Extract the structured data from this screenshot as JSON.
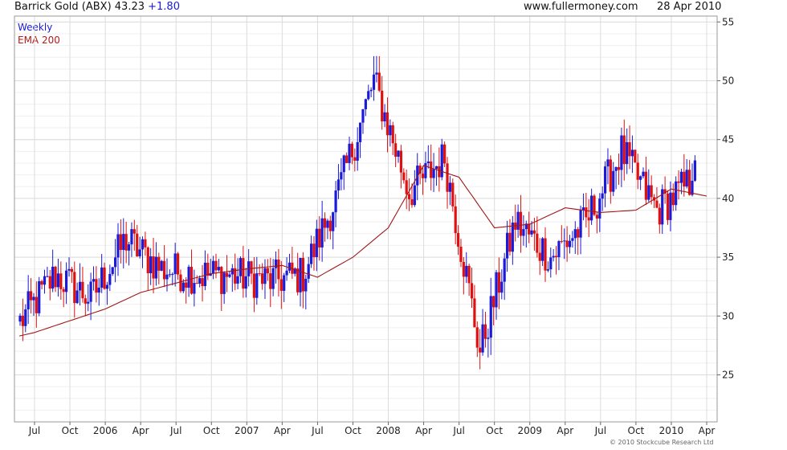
{
  "header": {
    "title": "Barrick Gold (ABX) 43.23",
    "change": "+1.80",
    "site": "www.fullermoney.com",
    "date": "28 Apr 2010"
  },
  "legend": {
    "weekly": "Weekly",
    "ema": "EMA 200"
  },
  "copyright": "© 2010 Stockcube Research Ltd",
  "chart_data": {
    "type": "candlestick",
    "title": "Barrick Gold (ABX) 43.23 +1.80",
    "frequency": "Weekly",
    "xlabel": "",
    "ylabel": "",
    "ylim": [
      21,
      55.5
    ],
    "y_ticks": [
      25,
      30,
      35,
      40,
      45,
      50,
      55
    ],
    "x_ticks": [
      "Jul",
      "Oct",
      "2006",
      "Apr",
      "Jul",
      "Oct",
      "2007",
      "Apr",
      "Jul",
      "Oct",
      "2008",
      "Apr",
      "Jul",
      "Oct",
      "2009",
      "Apr",
      "Jul",
      "Oct",
      "2010",
      "Apr"
    ],
    "grid": true,
    "legend_position": "top-left",
    "colors": {
      "up": "#1a1ad8",
      "down": "#e01010",
      "ema": "#a01818",
      "grid": "#dcdcdc"
    },
    "series": [
      {
        "name": "Weekly",
        "kind": "price-close",
        "points": [
          [
            "Jul",
            29.5
          ],
          [
            "Oct",
            33.5
          ],
          [
            "2006",
            31.5
          ],
          [
            "Apr",
            36.5
          ],
          [
            "Jul",
            34.0
          ],
          [
            "Oct",
            33.5
          ],
          [
            "2007",
            33.5
          ],
          [
            "Apr",
            33.0
          ],
          [
            "Jul",
            33.5
          ],
          [
            "Oct",
            40.5
          ],
          [
            "2008",
            50.0
          ],
          [
            "Apr",
            40.5
          ],
          [
            "Jul",
            43.5
          ],
          [
            "Oct",
            27.0
          ],
          [
            "2009",
            38.0
          ],
          [
            "Apr",
            35.0
          ],
          [
            "Jul",
            38.0
          ],
          [
            "Oct",
            44.0
          ],
          [
            "2010",
            39.0
          ],
          [
            "Apr",
            41.5
          ]
        ],
        "last_close": 43.23
      },
      {
        "name": "EMA 200",
        "kind": "moving-average",
        "points": [
          [
            "Jul",
            28.6
          ],
          [
            "Oct",
            29.6
          ],
          [
            "2006",
            30.6
          ],
          [
            "Apr",
            32.0
          ],
          [
            "Jul",
            32.8
          ],
          [
            "Oct",
            33.6
          ],
          [
            "2007",
            34.0
          ],
          [
            "Apr",
            34.3
          ],
          [
            "Jul",
            33.3
          ],
          [
            "Oct",
            35.0
          ],
          [
            "2008",
            37.5
          ],
          [
            "Apr",
            42.8
          ],
          [
            "Jul",
            41.8
          ],
          [
            "Oct",
            37.5
          ],
          [
            "2009",
            37.8
          ],
          [
            "Apr",
            39.2
          ],
          [
            "Jul",
            38.8
          ],
          [
            "Oct",
            39.0
          ],
          [
            "2010",
            40.8
          ],
          [
            "Apr",
            40.2
          ]
        ]
      }
    ]
  }
}
